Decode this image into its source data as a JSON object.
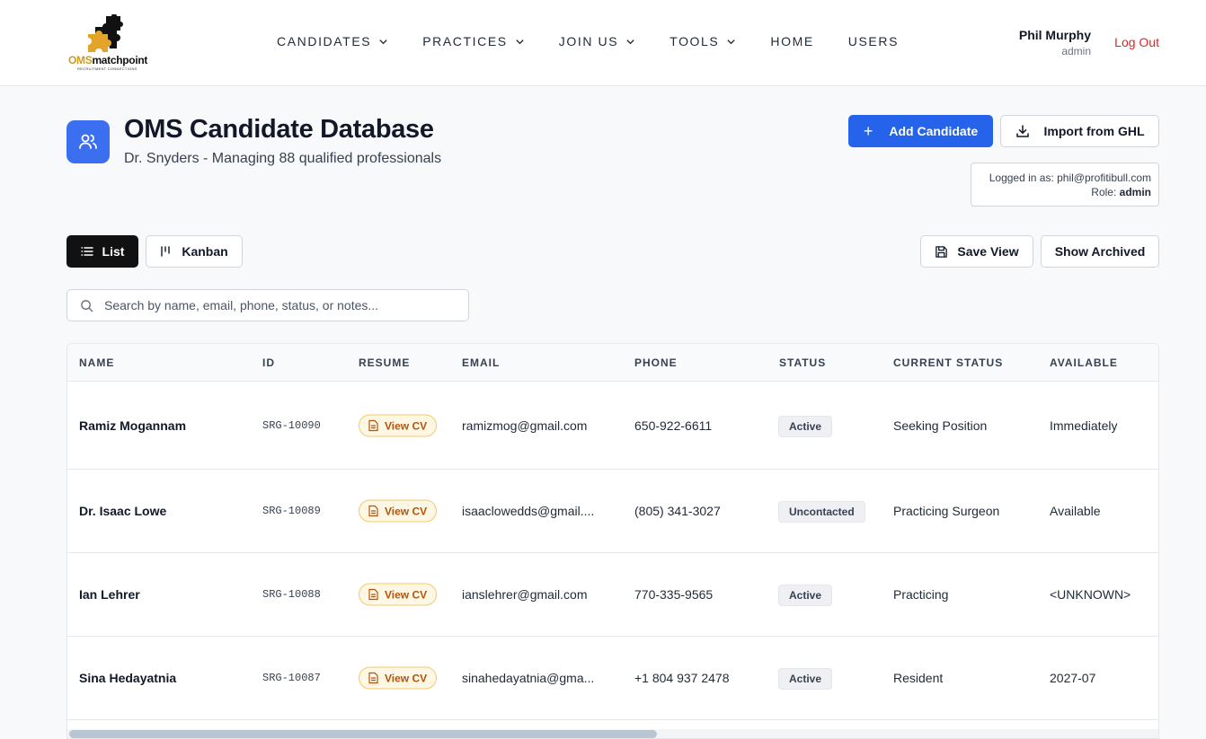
{
  "brand": {
    "logo_text_prefix": "OMS",
    "logo_text_suffix": "matchpoint",
    "logo_tagline": "RECRUITMENT CONNECTIONS",
    "accent": "#d19a1d"
  },
  "nav": {
    "items": [
      {
        "label": "CANDIDATES",
        "has_dropdown": true
      },
      {
        "label": "PRACTICES",
        "has_dropdown": true
      },
      {
        "label": "JOIN US",
        "has_dropdown": true
      },
      {
        "label": "TOOLS",
        "has_dropdown": true
      },
      {
        "label": "HOME",
        "has_dropdown": false
      },
      {
        "label": "USERS",
        "has_dropdown": false
      }
    ],
    "user_name": "Phil Murphy",
    "user_role": "admin",
    "logout_label": "Log Out"
  },
  "header": {
    "title": "OMS Candidate Database",
    "subtitle": "Dr. Snyders - Managing 88 qualified professionals",
    "add_button": "Add Candidate",
    "import_button": "Import from GHL",
    "login_label": "Logged in as: phil@profitibull.com",
    "role_label": "Role:",
    "role_value": "admin",
    "primary_color": "#2563eb"
  },
  "toolbar": {
    "list_label": "List",
    "kanban_label": "Kanban",
    "save_view_label": "Save View",
    "show_archived_label": "Show Archived"
  },
  "search": {
    "placeholder": "Search by name, email, phone, status, or notes...",
    "value": ""
  },
  "table": {
    "columns": [
      "NAME",
      "ID",
      "RESUME",
      "EMAIL",
      "PHONE",
      "STATUS",
      "CURRENT STATUS",
      "AVAILABLE"
    ],
    "rows": [
      {
        "name": "Ramiz Mogannam",
        "id": "SRG-10090",
        "resume": "View CV",
        "email": "ramizmog@gmail.com",
        "phone": "650-922-6611",
        "status": "Active",
        "current_status": "Seeking Position",
        "available": "Immediately"
      },
      {
        "name": "Dr. Isaac Lowe",
        "id": "SRG-10089",
        "resume": "View CV",
        "email": "isaaclowedds@gmail....",
        "phone": "(805) 341-3027",
        "status": "Uncontacted",
        "current_status": "Practicing Surgeon",
        "available": "Available"
      },
      {
        "name": "Ian Lehrer",
        "id": "SRG-10088",
        "resume": "View CV",
        "email": "ianslehrer@gmail.com",
        "phone": "770-335-9565",
        "status": "Active",
        "current_status": "Practicing",
        "available": "<UNKNOWN>"
      },
      {
        "name": "Sina Hedayatnia",
        "id": "SRG-10087",
        "resume": "View CV",
        "email": "sinahedayatnia@gma...",
        "phone": "+1 804 937 2478",
        "status": "Active",
        "current_status": "Resident",
        "available": "2027-07"
      }
    ]
  }
}
